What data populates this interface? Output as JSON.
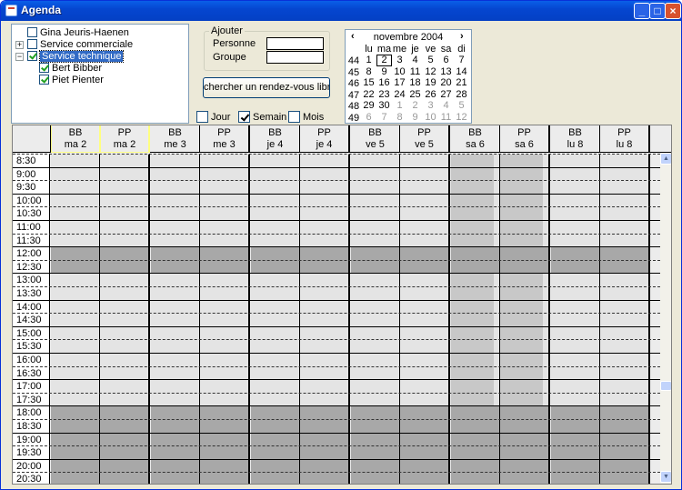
{
  "window": {
    "title": "Agenda",
    "minimize_icon": "minimize-icon",
    "maximize_icon": "maximize-icon",
    "close_icon": "close-icon"
  },
  "tree": {
    "items": [
      {
        "label": "Gina Jeuris-Haenen",
        "checked": false,
        "level": 0,
        "expander": ""
      },
      {
        "label": "Service commerciale",
        "checked": false,
        "level": 0,
        "expander": "+"
      },
      {
        "label": "Service technique",
        "checked": true,
        "level": 0,
        "expander": "-",
        "selected": true
      },
      {
        "label": "Bert Bibber",
        "checked": true,
        "level": 1,
        "expander": ""
      },
      {
        "label": "Piet Pienter",
        "checked": true,
        "level": 1,
        "expander": ""
      }
    ]
  },
  "ajouter": {
    "legend": "Ajouter",
    "personne_label": "Personne",
    "groupe_label": "Groupe",
    "personne_value": "",
    "groupe_value": ""
  },
  "search_button": "chercher un rendez-vous libre <I",
  "view_mode": {
    "options": [
      {
        "label": "Jour",
        "checked": false
      },
      {
        "label": "Semain",
        "checked": true
      },
      {
        "label": "Mois",
        "checked": false
      }
    ]
  },
  "calendar": {
    "month": "novembre 2004",
    "prev": "‹",
    "next": "›",
    "day_headers": [
      "lu",
      "ma",
      "me",
      "je",
      "ve",
      "sa",
      "di"
    ],
    "weeks": [
      {
        "wk": "44",
        "days": [
          "1",
          "2",
          "3",
          "4",
          "5",
          "6",
          "7"
        ]
      },
      {
        "wk": "45",
        "days": [
          "8",
          "9",
          "10",
          "11",
          "12",
          "13",
          "14"
        ]
      },
      {
        "wk": "46",
        "days": [
          "15",
          "16",
          "17",
          "18",
          "19",
          "20",
          "21"
        ]
      },
      {
        "wk": "47",
        "days": [
          "22",
          "23",
          "24",
          "25",
          "26",
          "27",
          "28"
        ]
      },
      {
        "wk": "48",
        "days": [
          "29",
          "30",
          "1",
          "2",
          "3",
          "4",
          "5"
        ]
      },
      {
        "wk": "49",
        "days": [
          "6",
          "7",
          "8",
          "9",
          "10",
          "11",
          "12"
        ]
      }
    ],
    "today": "2"
  },
  "agenda": {
    "columns": [
      {
        "initials": "BB",
        "day": "ma 2",
        "today": true,
        "weekend": false
      },
      {
        "initials": "PP",
        "day": "ma 2",
        "today": true,
        "weekend": false
      },
      {
        "initials": "BB",
        "day": "me 3",
        "weekend": false
      },
      {
        "initials": "PP",
        "day": "me 3",
        "weekend": false
      },
      {
        "initials": "BB",
        "day": "je 4",
        "weekend": false
      },
      {
        "initials": "PP",
        "day": "je 4",
        "weekend": false
      },
      {
        "initials": "BB",
        "day": "ve 5",
        "weekend": false
      },
      {
        "initials": "PP",
        "day": "ve 5",
        "weekend": false
      },
      {
        "initials": "BB",
        "day": "sa 6",
        "weekend": true
      },
      {
        "initials": "PP",
        "day": "sa 6",
        "weekend": true
      },
      {
        "initials": "BB",
        "day": "lu 8",
        "weekend": false
      },
      {
        "initials": "PP",
        "day": "lu 8",
        "weekend": false
      }
    ],
    "times": [
      "8:30",
      "9:00",
      "9:30",
      "10:00",
      "10:30",
      "11:00",
      "11:30",
      "12:00",
      "12:30",
      "13:00",
      "13:30",
      "14:00",
      "14:30",
      "15:00",
      "15:30",
      "16:00",
      "16:30",
      "17:00",
      "17:30",
      "18:00",
      "18:30",
      "19:00",
      "19:30",
      "20:00",
      "20:30"
    ],
    "break_slots": [
      "12:00",
      "12:30"
    ],
    "evening_slots": [
      "18:00",
      "18:30",
      "19:00",
      "19:30",
      "20:00",
      "20:30"
    ],
    "colors": {
      "work": "#e4e4e4",
      "off": "#a8a8a8",
      "weekend": "#c8c8c8"
    }
  }
}
